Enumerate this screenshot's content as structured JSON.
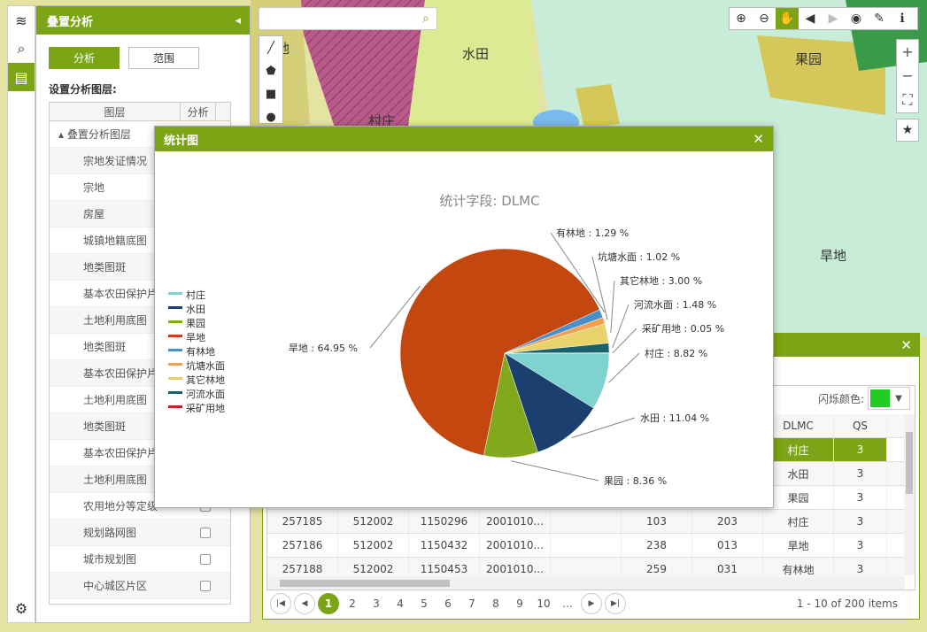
{
  "map": {
    "labels": [
      "地",
      "水田",
      "果园",
      "村庄",
      "旱地",
      "有林地",
      "旱地",
      "村庄"
    ]
  },
  "search": {
    "placeholder": ""
  },
  "toolbar_icons": [
    "zoom-in-icon",
    "zoom-out-icon",
    "pan-icon",
    "back-icon",
    "forward-icon",
    "full-extent-icon",
    "measure-icon",
    "info-icon"
  ],
  "panel": {
    "title": "叠置分析",
    "tabs": [
      "分析",
      "范围"
    ],
    "subtitle": "设置分析图层:",
    "col_layer": "图层",
    "col_analyze": "分析",
    "group": "叠置分析图层",
    "layers": [
      "宗地发证情况",
      "宗地",
      "房屋",
      "城镇地籍底图",
      "地类图斑",
      "基本农田保护片",
      "土地利用底图",
      "地类图斑",
      "基本农田保护片",
      "土地利用底图",
      "地类图斑",
      "基本农田保护片",
      "土地利用底图",
      "农用地分等定级",
      "规划路网图",
      "城市规划图",
      "中心城区片区"
    ]
  },
  "stats": {
    "title": "统计图",
    "close": "✕"
  },
  "attr": {
    "close": "✕",
    "flash_label": "闪烁颜色:",
    "flash_color": "#22cc22",
    "header": [
      "",
      "",
      "",
      "",
      "",
      "",
      "",
      "DLMC",
      "QS"
    ],
    "rows": [
      [
        "",
        "",
        "",
        "",
        "",
        "",
        "",
        "村庄",
        "3"
      ],
      [
        "",
        "",
        "",
        "",
        "",
        "",
        "",
        "水田",
        "3"
      ],
      [
        "",
        "",
        "",
        "",
        "",
        "",
        "",
        "果园",
        "3"
      ],
      [
        "257185",
        "512002",
        "1150296",
        "2001010...",
        "",
        "103",
        "203",
        "村庄",
        "3"
      ],
      [
        "257186",
        "512002",
        "1150432",
        "2001010...",
        "",
        "238",
        "013",
        "旱地",
        "3"
      ],
      [
        "257188",
        "512002",
        "1150453",
        "2001010...",
        "",
        "259",
        "031",
        "有林地",
        "3"
      ]
    ],
    "pages": [
      "1",
      "2",
      "3",
      "4",
      "5",
      "6",
      "7",
      "8",
      "9",
      "10",
      "..."
    ],
    "page_info": "1 - 10 of 200 items"
  },
  "chart_data": {
    "type": "pie",
    "title": "统计字段: DLMC",
    "legend_position": "left",
    "slices": [
      {
        "name": "村庄",
        "value": 8.82,
        "label": "村庄 : 8.82 %",
        "color": "#7fd3cf"
      },
      {
        "name": "水田",
        "value": 11.04,
        "label": "水田 : 11.04 %",
        "color": "#1b3f6e"
      },
      {
        "name": "果园",
        "value": 8.36,
        "label": "果园 : 8.36 %",
        "color": "#82a81c"
      },
      {
        "name": "旱地",
        "value": 64.95,
        "label": "旱地 : 64.95 %",
        "color": "#c4470f"
      },
      {
        "name": "有林地",
        "value": 1.29,
        "label": "有林地 : 1.29 %",
        "color": "#4a90c8"
      },
      {
        "name": "坑塘水面",
        "value": 1.02,
        "label": "坑塘水面 : 1.02 %",
        "color": "#f0a050"
      },
      {
        "name": "其它林地",
        "value": 3.0,
        "label": "其它林地 : 3.00 %",
        "color": "#e7d36a"
      },
      {
        "name": "河流水面",
        "value": 1.48,
        "label": "河流水面 : 1.48 %",
        "color": "#19616a"
      },
      {
        "name": "采矿用地",
        "value": 0.05,
        "label": "采矿用地 : 0.05 %",
        "color": "#b8282a"
      }
    ]
  }
}
